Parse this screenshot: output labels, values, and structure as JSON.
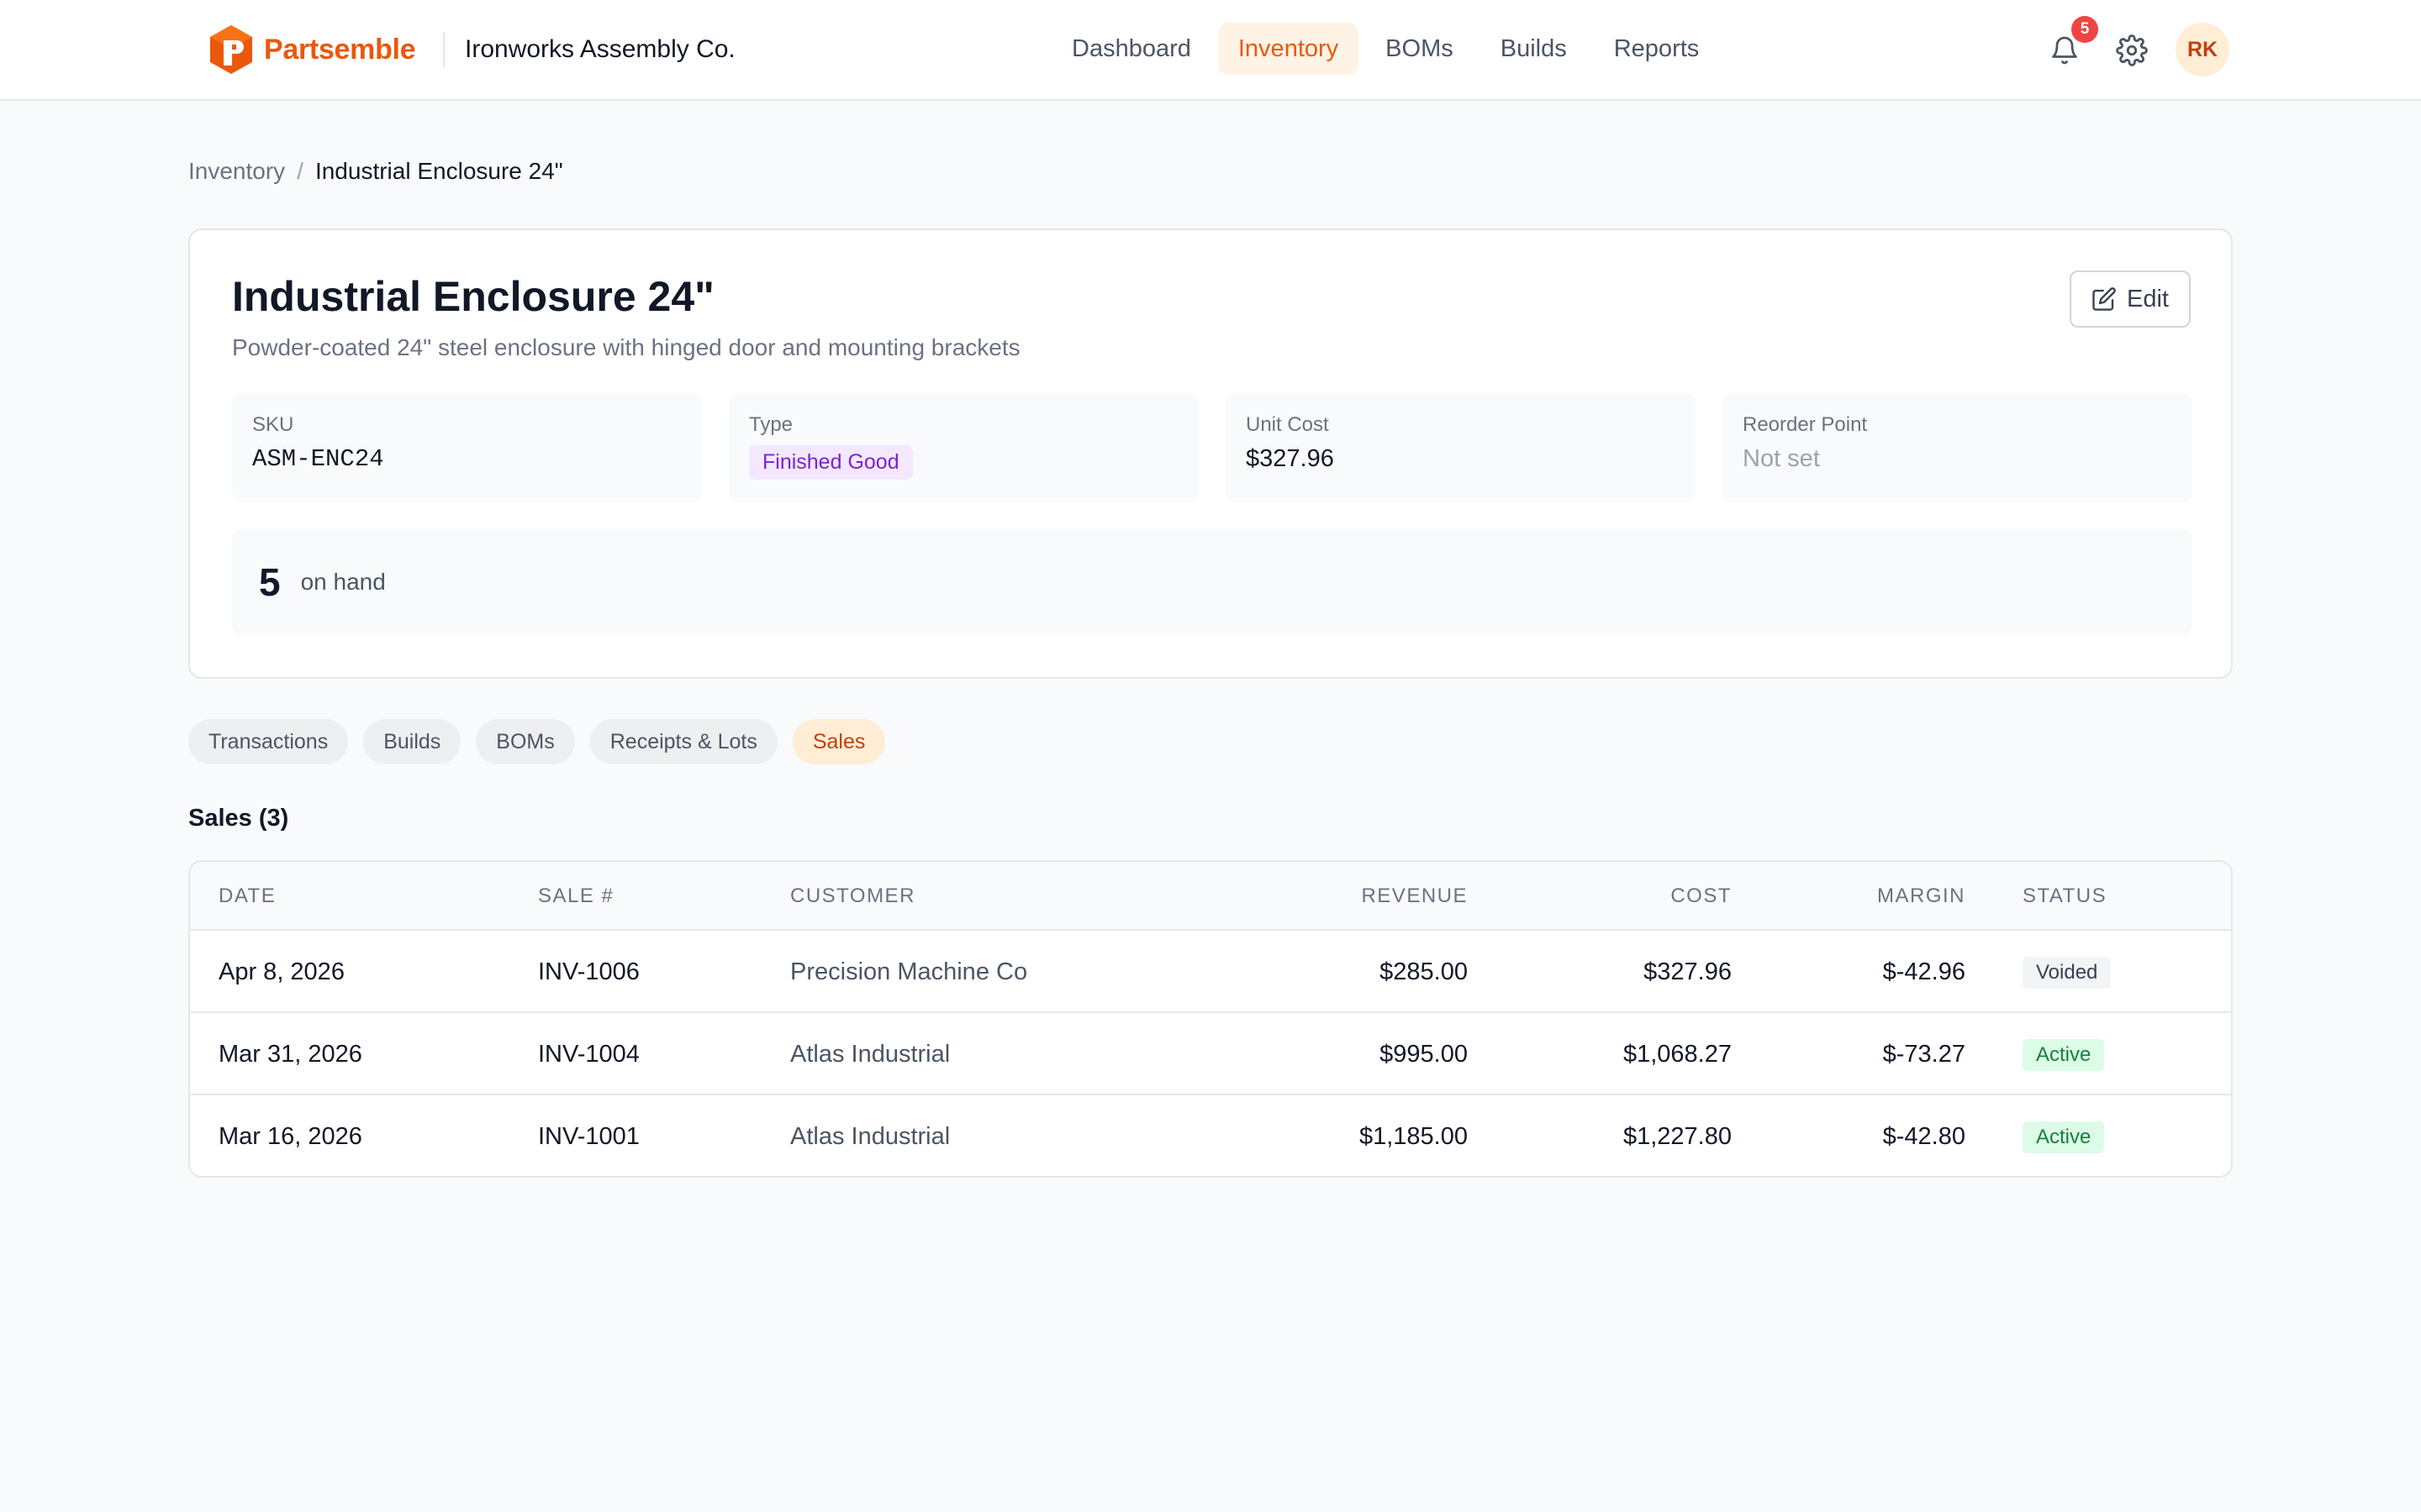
{
  "brand": {
    "name": "Partsemble",
    "accent": "#ea580c"
  },
  "org_name": "Ironworks Assembly Co.",
  "nav": [
    {
      "label": "Dashboard",
      "active": false
    },
    {
      "label": "Inventory",
      "active": true
    },
    {
      "label": "BOMs",
      "active": false
    },
    {
      "label": "Builds",
      "active": false
    },
    {
      "label": "Reports",
      "active": false
    }
  ],
  "header": {
    "notification_count": "5",
    "avatar_initials": "RK",
    "bell_icon": "bell-icon",
    "settings_icon": "gear-icon"
  },
  "breadcrumb": {
    "parent": "Inventory",
    "separator": "/",
    "current": "Industrial Enclosure 24\""
  },
  "item": {
    "title": "Industrial Enclosure 24\"",
    "description": "Powder-coated 24\" steel enclosure with hinged door and mounting brackets",
    "edit_label": "Edit",
    "sku_label": "SKU",
    "sku": "ASM-ENC24",
    "type_label": "Type",
    "type": "Finished Good",
    "unit_cost_label": "Unit Cost",
    "unit_cost": "$327.96",
    "reorder_label": "Reorder Point",
    "reorder": "Not set",
    "on_hand": "5",
    "on_hand_label": "on hand"
  },
  "tabs": [
    {
      "label": "Transactions",
      "active": false
    },
    {
      "label": "Builds",
      "active": false
    },
    {
      "label": "BOMs",
      "active": false
    },
    {
      "label": "Receipts & Lots",
      "active": false
    },
    {
      "label": "Sales",
      "active": true
    }
  ],
  "sales": {
    "title": "Sales (3)",
    "columns": {
      "date": "DATE",
      "sale": "SALE #",
      "customer": "CUSTOMER",
      "revenue": "REVENUE",
      "cost": "COST",
      "margin": "MARGIN",
      "status": "STATUS"
    },
    "rows": [
      {
        "date": "Apr 8, 2026",
        "sale": "INV-1006",
        "customer": "Precision Machine Co",
        "revenue": "$285.00",
        "cost": "$327.96",
        "margin": "$-42.96",
        "status": "Voided",
        "status_kind": "voided"
      },
      {
        "date": "Mar 31, 2026",
        "sale": "INV-1004",
        "customer": "Atlas Industrial",
        "revenue": "$995.00",
        "cost": "$1,068.27",
        "margin": "$-73.27",
        "status": "Active",
        "status_kind": "active"
      },
      {
        "date": "Mar 16, 2026",
        "sale": "INV-1001",
        "customer": "Atlas Industrial",
        "revenue": "$1,185.00",
        "cost": "$1,227.80",
        "margin": "$-42.80",
        "status": "Active",
        "status_kind": "active"
      }
    ]
  }
}
